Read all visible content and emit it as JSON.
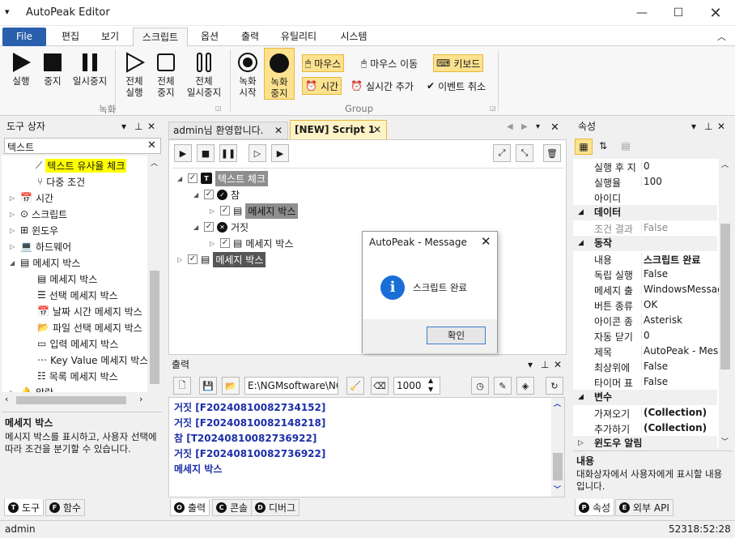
{
  "window": {
    "title": "AutoPeak Editor"
  },
  "ribbon_tabs": [
    "File",
    "편집",
    "보기",
    "스크립트",
    "옵션",
    "출력",
    "유틸리티",
    "시스템"
  ],
  "ribbon": {
    "run": "실행",
    "stop": "중지",
    "pause": "일시중지",
    "run_all": [
      "전체",
      "실행"
    ],
    "stop_all": [
      "전체",
      "중지"
    ],
    "pause_all": [
      "전체",
      "일시중지"
    ],
    "record_start": [
      "녹화",
      "시작"
    ],
    "record_stop": [
      "녹화",
      "중지"
    ],
    "mouse": "마우스",
    "mouse_move": "마우스 이동",
    "keyboard": "키보드",
    "time": "시간",
    "add_realtime": "실시간 추가",
    "cancel_event": "이벤트 취소",
    "group_record": "녹화",
    "group_group": "Group"
  },
  "toolbox": {
    "title": "도구 상자",
    "search": "텍스트",
    "items": [
      "텍스트 유사율 체크",
      "다중 조건",
      "시간",
      "스크립트",
      "윈도우",
      "하드웨어",
      "메세지 박스",
      "메세지 박스",
      "선택 메세지 박스",
      "날짜 시간 메세지 박스",
      "파일 선택 메세지 박스",
      "입력 메세지 박스",
      "Key Value 메세지 박스",
      "목록 메세지 박스",
      "알람"
    ],
    "desc_title": "메세지 박스",
    "desc": "메시지 박스를 표시하고, 사용자 선택에 따라 조건을 분기할 수 있습니다.",
    "tabs": [
      "도구",
      "함수"
    ]
  },
  "doc_tabs": [
    "admin님 환영합니다.",
    "[NEW] Script 1"
  ],
  "script_tree": [
    "텍스트 체크",
    "참",
    "메세지 박스",
    "거짓",
    "메세지 박스",
    "메세지 박스"
  ],
  "dialog": {
    "title": "AutoPeak - Message",
    "message": "스크립트 완료",
    "ok": "확인"
  },
  "output": {
    "title": "출력",
    "path": "E:\\NGMsoftware\\NG",
    "count": "1000",
    "lines": [
      "거짓 [F20240810082734152]",
      "거짓 [F20240810082148218]",
      "참 [T20240810082736922]",
      "거짓 [F20240810082736922]",
      "메세지 박스"
    ],
    "tabs": [
      "출력",
      "콘솔",
      "디버그"
    ]
  },
  "properties": {
    "title": "속성",
    "rows": [
      {
        "k": "실행 후 지",
        "v": "0"
      },
      {
        "k": "실행율",
        "v": "100"
      },
      {
        "k": "아이디",
        "v": ""
      }
    ],
    "cat_data": "데이터",
    "data_rows": [
      {
        "k": "조건 결과",
        "v": "False"
      }
    ],
    "cat_action": "동작",
    "action_rows": [
      {
        "k": "내용",
        "v": "스크립트 완료"
      },
      {
        "k": "독립 실행",
        "v": "False"
      },
      {
        "k": "메세지 출",
        "v": "WindowsMessage"
      },
      {
        "k": "버튼 종류",
        "v": "OK"
      },
      {
        "k": "아이콘 종",
        "v": "Asterisk"
      },
      {
        "k": "자동 닫기",
        "v": "0"
      },
      {
        "k": "제목",
        "v": "AutoPeak - Message"
      },
      {
        "k": "최상위에",
        "v": "False"
      },
      {
        "k": "타이머 표",
        "v": "False"
      }
    ],
    "cat_var": "변수",
    "var_rows": [
      {
        "k": "가져오기",
        "v": "(Collection)"
      },
      {
        "k": "추가하기",
        "v": "(Collection)"
      }
    ],
    "cat_win": "윈도우 알림",
    "desc_title": "내용",
    "desc": "대화상자에서 사용자에게 표시할 내용입니다.",
    "tabs": [
      "속성",
      "외부 API"
    ]
  },
  "status": {
    "user": "admin",
    "time": "52318:52:28"
  }
}
